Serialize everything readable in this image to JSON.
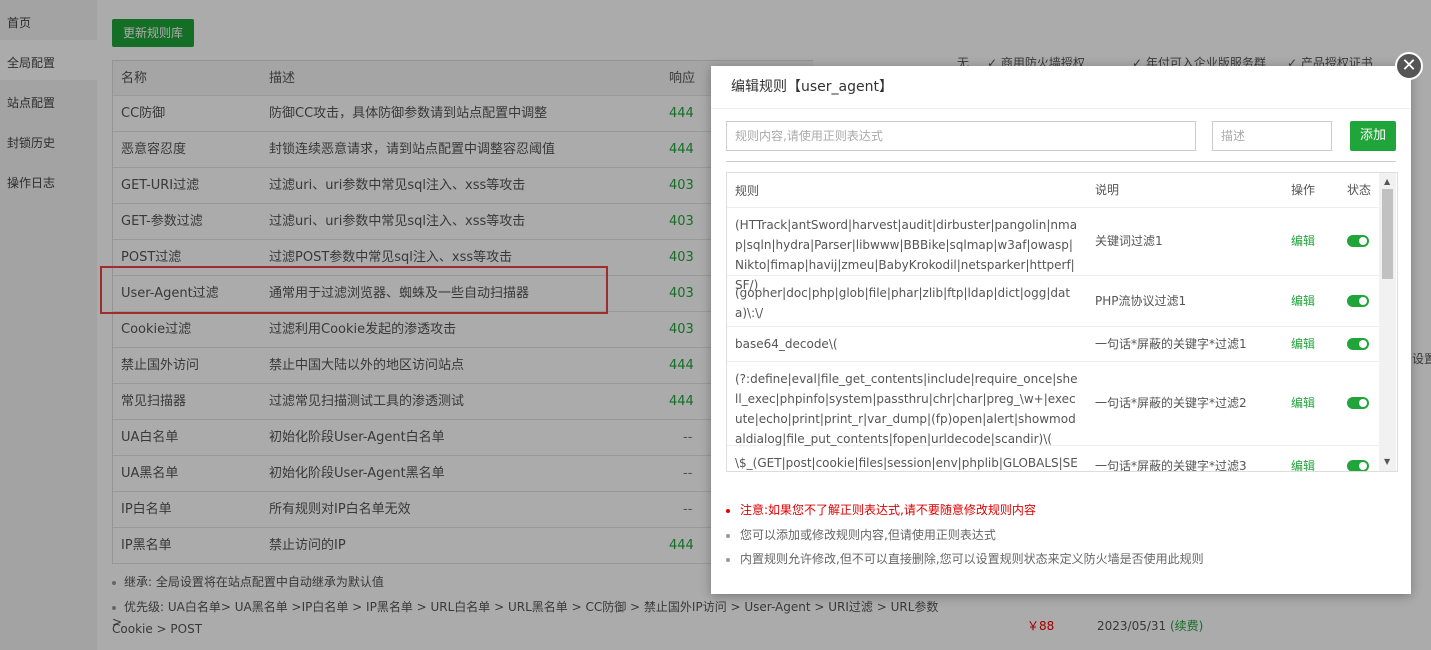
{
  "sidebar": {
    "items": [
      "首页",
      "全局配置",
      "站点配置",
      "封锁历史",
      "操作日志"
    ]
  },
  "main": {
    "update_button": "更新规则库",
    "columns": {
      "name": "名称",
      "desc": "描述",
      "resp": "响应"
    },
    "rows": [
      {
        "name": "CC防御",
        "desc": "防御CC攻击，具体防御参数请到站点配置中调整",
        "resp": "444"
      },
      {
        "name": "恶意容忍度",
        "desc": "封锁连续恶意请求，请到站点配置中调整容忍阈值",
        "resp": "444"
      },
      {
        "name": "GET-URI过滤",
        "desc": "过滤uri、uri参数中常见sql注入、xss等攻击",
        "resp": "403"
      },
      {
        "name": "GET-参数过滤",
        "desc": "过滤uri、uri参数中常见sql注入、xss等攻击",
        "resp": "403"
      },
      {
        "name": "POST过滤",
        "desc": "过滤POST参数中常见sql注入、xss等攻击",
        "resp": "403"
      },
      {
        "name": "User-Agent过滤",
        "desc": "通常用于过滤浏览器、蜘蛛及一些自动扫描器",
        "resp": "403"
      },
      {
        "name": "Cookie过滤",
        "desc": "过滤利用Cookie发起的渗透攻击",
        "resp": "403"
      },
      {
        "name": "禁止国外访问",
        "desc": "禁止中国大陆以外的地区访问站点",
        "resp": "444"
      },
      {
        "name": "常见扫描器",
        "desc": "过滤常见扫描测试工具的渗透测试",
        "resp": "444"
      },
      {
        "name": "UA白名单",
        "desc": "初始化阶段User-Agent白名单",
        "resp": "--"
      },
      {
        "name": "UA黑名单",
        "desc": "初始化阶段User-Agent黑名单",
        "resp": "--"
      },
      {
        "name": "IP白名单",
        "desc": "所有规则对IP白名单无效",
        "resp": "--"
      },
      {
        "name": "IP黑名单",
        "desc": "禁止访问的IP",
        "resp": "444"
      }
    ],
    "footer_inherit": "继承: 全局设置将在站点配置中自动继承为默认值",
    "footer_priority_1": "优先级: UA白名单> UA黑名单 >IP白名单 > IP黑名单 > URL白名单 > URL黑名单 > CC防御 > 禁止国外IP访问 > User-Agent > URI过滤 > URL参数 >",
    "footer_priority_2": "Cookie > POST"
  },
  "background": {
    "top_items": [
      "无",
      "商用防火墙授权",
      "年付可入企业版服务群",
      "产品授权证书"
    ],
    "side_text": "设置",
    "price": "￥88",
    "date": "2023/05/31",
    "renew": "(续费)"
  },
  "modal": {
    "title": "编辑规则【user_agent】",
    "rule_placeholder": "规则内容,请使用正则表达式",
    "desc_placeholder": "描述",
    "add_button": "添加",
    "columns": {
      "rule": "规则",
      "desc": "说明",
      "op": "操作",
      "status": "状态"
    },
    "rules": [
      {
        "rule": "(HTTrack|antSword|harvest|audit|dirbuster|pangolin|nmap|sqln|hydra|Parser|libwww|BBBike|sqlmap|w3af|owasp|Nikto|fimap|havij|zmeu|BabyKrokodil|netsparker|httperf| SF/)",
        "desc": "关键词过滤1",
        "edit": "编辑",
        "enabled": true
      },
      {
        "rule": "(gopher|doc|php|glob|file|phar|zlib|ftp|ldap|dict|ogg|data)\\:\\/",
        "desc": "PHP流协议过滤1",
        "edit": "编辑",
        "enabled": true
      },
      {
        "rule": "base64_decode\\(",
        "desc": "一句话*屏蔽的关键字*过滤1",
        "edit": "编辑",
        "enabled": true
      },
      {
        "rule": "(?:define|eval|file_get_contents|include|require_once|shell_exec|phpinfo|system|passthru|chr|char|preg_\\w+|execute|echo|print|print_r|var_dump|(fp)open|alert|showmodaldialog|file_put_contents|fopen|urldecode|scandir)\\(",
        "desc": "一句话*屏蔽的关键字*过滤2",
        "edit": "编辑",
        "enabled": true
      },
      {
        "rule": "\\$_(GET|post|cookie|files|session|env|phplib|GLOBALS|SERV",
        "desc": "一句话*屏蔽的关键字*过滤3",
        "edit": "编辑",
        "enabled": true
      }
    ],
    "notes": [
      {
        "text": "注意:如果您不了解正则表达式,请不要随意修改规则内容",
        "color": "#e00000"
      },
      {
        "text": "您可以添加或修改规则内容,但请使用正则表达式",
        "color": "#666666"
      },
      {
        "text": "内置规则允许修改,但不可以直接删除,您可以设置规则状态来定义防火墙是否使用此规则",
        "color": "#666666"
      }
    ]
  }
}
